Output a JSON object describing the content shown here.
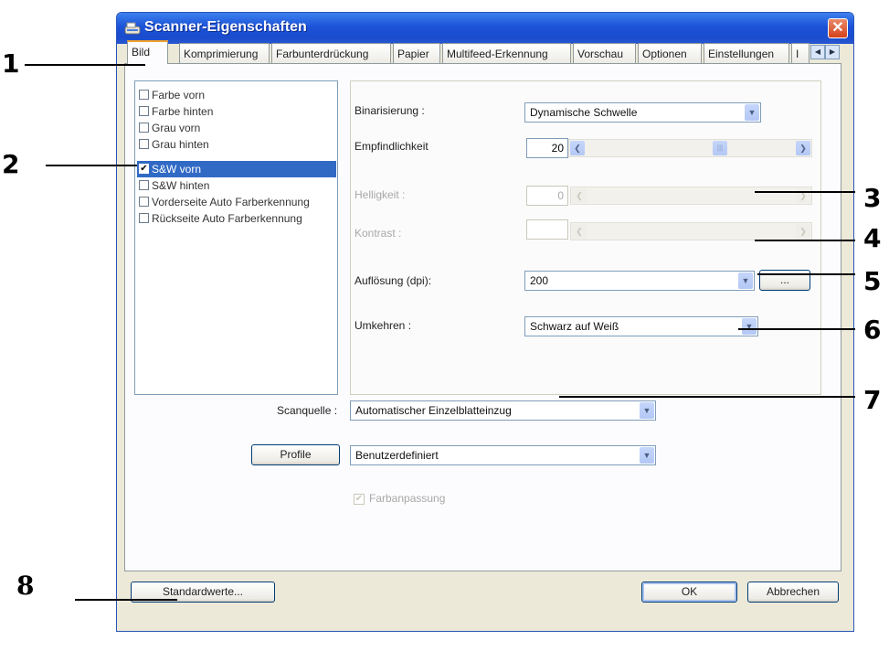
{
  "window": {
    "title": "Scanner-Eigenschaften",
    "close_glyph": "✕"
  },
  "tabs": [
    "Bild",
    "Komprimierung",
    "Farbunterdrückung",
    "Papier",
    "Multifeed-Erkennung",
    "Vorschau",
    "Optionen",
    "Einstellungen",
    "I"
  ],
  "tab_scroll": {
    "left": "◀",
    "right": "▶"
  },
  "image_types": [
    {
      "label": "Farbe vorn",
      "checked": false,
      "selected": false
    },
    {
      "label": "Farbe hinten",
      "checked": false,
      "selected": false
    },
    {
      "label": "Grau vorn",
      "checked": false,
      "selected": false
    },
    {
      "label": "Grau hinten",
      "checked": false,
      "selected": false
    },
    {
      "label": "S&W vorn",
      "checked": true,
      "selected": true
    },
    {
      "label": "S&W hinten",
      "checked": false,
      "selected": false
    },
    {
      "label": "Vorderseite Auto Farberkennung",
      "checked": false,
      "selected": false
    },
    {
      "label": "Rückseite Auto Farberkennung",
      "checked": false,
      "selected": false
    }
  ],
  "settings": {
    "binarization": {
      "label": "Binarisierung :",
      "value": "Dynamische Schwelle"
    },
    "sensitivity": {
      "label": "Empfindlichkeit",
      "value": "20"
    },
    "brightness": {
      "label": "Helligkeit :",
      "value": "0"
    },
    "contrast": {
      "label": "Kontrast :",
      "value": ""
    },
    "resolution": {
      "label": "Auflösung (dpi):",
      "value": "200",
      "more_button": "..."
    },
    "invert": {
      "label": "Umkehren :",
      "value": "Schwarz auf Weiß"
    }
  },
  "scan_source": {
    "label": "Scanquelle :",
    "value": "Automatischer Einzelblatteinzug"
  },
  "profile": {
    "button": "Profile",
    "value": "Benutzerdefiniert"
  },
  "color_matching": {
    "label": "Farbanpassung",
    "checked": true
  },
  "buttons": {
    "defaults": "Standardwerte...",
    "ok": "OK",
    "cancel": "Abbrechen"
  },
  "callouts": [
    "1",
    "2",
    "3",
    "4",
    "5",
    "6",
    "7",
    "8"
  ],
  "glyphs": {
    "dropdown": "▼",
    "left": "❮",
    "right": "❯",
    "thumb": "|||",
    "check": "✔"
  },
  "colors": {
    "title_bar": "#1b52d8",
    "selection": "#316ac5",
    "active_tab_accent": "#f1a32f"
  }
}
